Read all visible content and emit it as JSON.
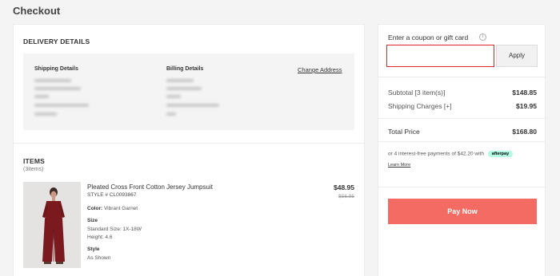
{
  "page": {
    "title": "Checkout"
  },
  "delivery": {
    "title": "DELIVERY DETAILS",
    "shipping_label": "Shipping Details",
    "billing_label": "Billing Details",
    "change_address": "Change Address"
  },
  "items": {
    "title": "ITEMS",
    "count": "(3items)",
    "product": {
      "name": "Pleated Cross Front Cotton Jersey Jumpsuit",
      "style": "STYLE # CL0093867",
      "color_label": "Color:",
      "color_value": "Vibrant Garnet",
      "size_label": "Size",
      "size_value": "Standard Size: 1X-18W",
      "height": "Height: 4.6",
      "style_label": "Style",
      "style_value": "As Shown",
      "price": "$48.95",
      "old_price": "$56.95",
      "image_color": "#7a1a1e"
    }
  },
  "summary": {
    "coupon_label": "Enter a coupon or gift card",
    "coupon_value": "",
    "apply_label": "Apply",
    "subtotal_label": "Subtotal [3 item(s)]",
    "subtotal_value": "$148.85",
    "shipping_label": "Shipping Charges [+]",
    "shipping_value": "$19.95",
    "total_label": "Total Price",
    "total_value": "$168.80",
    "installment_text": "or 4 interest-free payments of $42.20 with",
    "afterpay_label": "afterpay",
    "learn_more": "Learn More",
    "pay_label": "Pay Now",
    "accent_color": "#f36b62",
    "coupon_border_color": "#e0252b"
  }
}
